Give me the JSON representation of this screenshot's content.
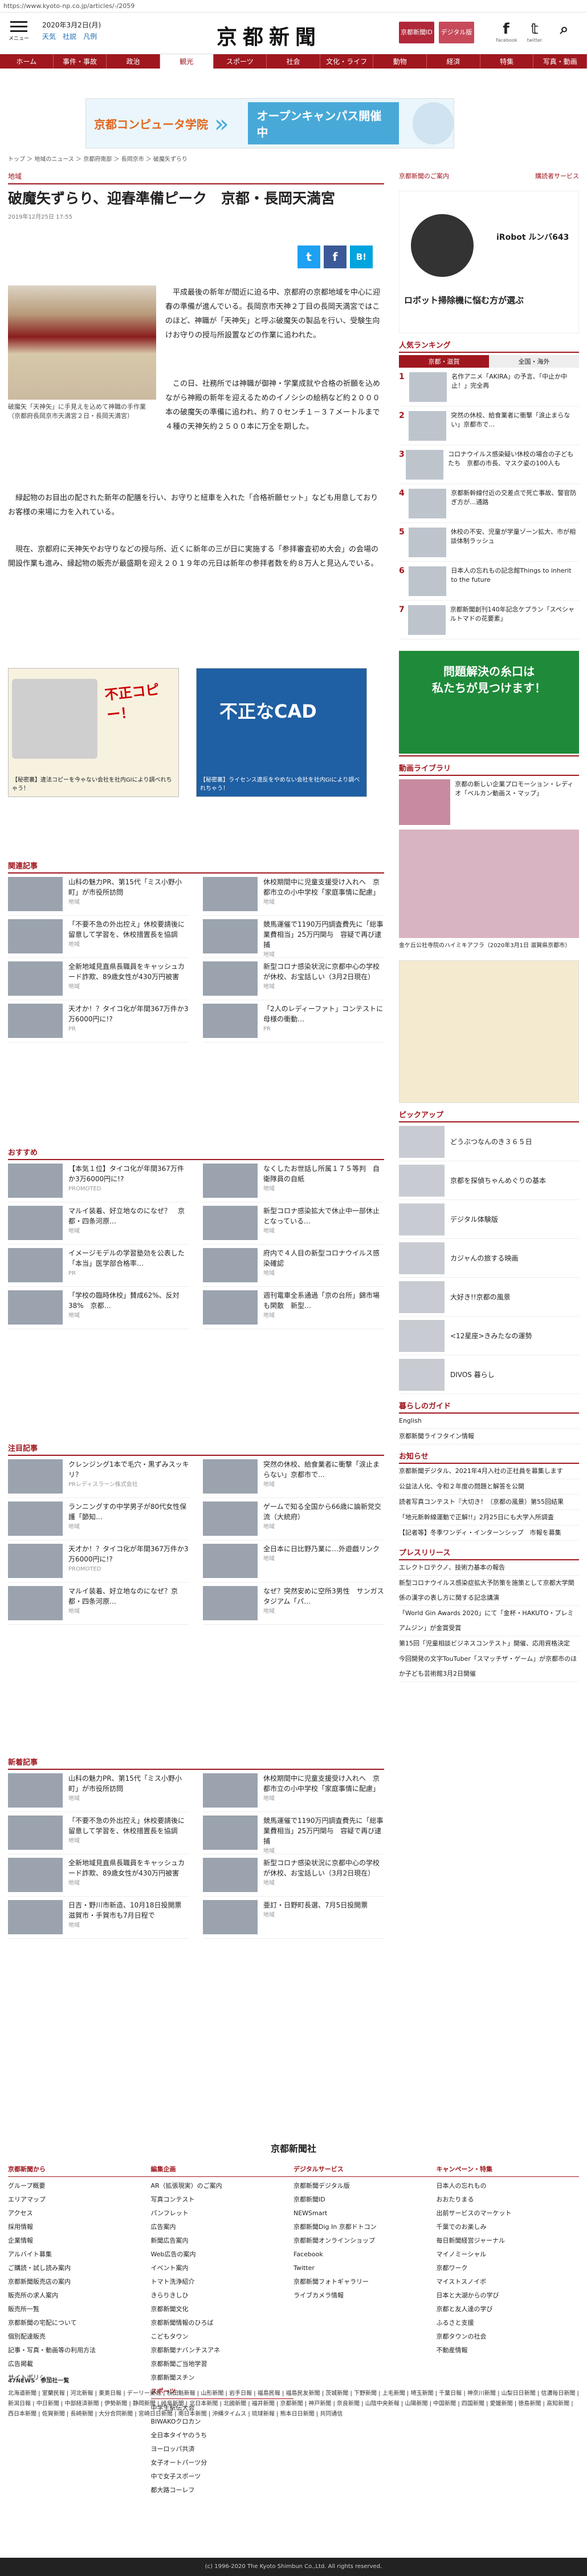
{
  "browser": {
    "url": "https://www.kyoto-np.co.jp/articles/-/2059"
  },
  "header": {
    "menu_label": "メニュー",
    "date": "2020年3月2日(月)",
    "weather": "天気",
    "traffic": "社説",
    "fortune": "凡例",
    "logo": "京都新聞",
    "login": "京都新聞ID",
    "digital": "デジタル版",
    "facebook": "Facebook",
    "twitter": "twitter"
  },
  "nav": [
    "ホーム",
    "事件・事故",
    "政治",
    "観光",
    "スポーツ",
    "社会",
    "文化・ライフ",
    "動物",
    "経済",
    "特集",
    "写真・動画"
  ],
  "banner": {
    "school": "京都コンピュータ学院",
    "cta": "オープンキャンパス開催中"
  },
  "breadcrumb": "トップ ＞ 地域のニュース ＞ 京都府南部 ＞ 長岡京市 ＞ 破魔矢ずらり",
  "article": {
    "category": "地域",
    "title": "破魔矢ずらり、迎春準備ピーク　京都・長岡天満宮",
    "timestamp": "2019年12月25日 17:55",
    "caption": "破魔矢「天神矢」に手見えを込めて神職の手作業（京都府長岡京市天満宮２日・長岡天満宮）",
    "paragraphs": [
      "平成最後の新年が間近に迫る中、京都府の京都地域を中心に迎春の準備が進んでいる。長岡京市天神２丁目の長岡天満宮ではこのほど、神職が「天神矢」と呼ぶ破魔矢の製品を行い、受験生向けお守りの授与所設置などの作業に追われた。",
      "この日、社務所では神職が御神・学業成就や合格の祈願を込めながら神殿の新年を迎えるためのイノシシの絵柄など約２０００本の破魔矢の準備に追われ、約７０センチ１－３７メートルまで４種の天神矢約２５００本に万全を期した。",
      "緑起物のお目出の配された新年の配膳を行い、お守りと紐車を入れた「合格祈願セット」なども用意しておりお客様の来場に力を入れている。",
      "現在、京都府に天神矢やお守りなどの授与所、近くに新年の三が日に実施する「参拝審査初め大会」の会場の開設作業も進み、縁起物の販売が最盛期を迎え２０１９年の元日は新年の参拝者数を約８万人と見込んでいる。"
    ],
    "share": {
      "twitter": "t",
      "facebook": "f",
      "hatena": "B!"
    }
  },
  "ads": [
    {
      "headline": "不正コピー！",
      "sub": "【秘密裏】違法コピーを今ゃない会社を社内GIにより調べれちゃう！"
    },
    {
      "headline": "不正なCAD",
      "sub": "【秘密裏】ライセンス違反をやめない会社を社内GIにより調べれちゃう！"
    }
  ],
  "related": {
    "title": "関連記事",
    "items": [
      {
        "text": "山科の魅力PR、第15代「ミス小野小町」が市役所訪問",
        "meta": "地域"
      },
      {
        "text": "休校期間中に児童支援受け入れへ　京都市立の小中学校「家庭事情に配慮」",
        "meta": "地域"
      },
      {
        "text": "「不要不急の外出控え」休校要請後に留意して学習を、休校措置長を協調",
        "meta": "地域"
      },
      {
        "text": "競馬運催で1190万円調査費先に「総事業費相当」25万円関与　容疑で再び逮捕",
        "meta": "地域"
      },
      {
        "text": "全新地域見直県長職員をキャッシュカード詐欺、89歳女性が430万円被害",
        "meta": "地域"
      },
      {
        "text": "新型コロナ感染状況に京都中心の学校が休校、お宝話しい（3月2日現在）",
        "meta": "地域"
      },
      {
        "text": "天才か！？タイコ化が年間367万件か3万6000円に!?",
        "meta": "PR"
      },
      {
        "text": "「2人のレディーファト」コンテストに母様の衝動…",
        "meta": "PR"
      }
    ]
  },
  "osusume": {
    "title": "おすすめ",
    "items": [
      {
        "text": "【本気１位】タイコ化が年間367万件か3万6000円に!?",
        "meta": "PROMOTED"
      },
      {
        "text": "なくしたお世話し所属１７５等判　自衛隊員の自紙",
        "meta": "地域"
      },
      {
        "text": "マルイ装着、好立地なのになぜ？　京都・四条河原…",
        "meta": "地域"
      },
      {
        "text": "新型コロナ感染拡大で休止中一部休止となっている…",
        "meta": "地域"
      },
      {
        "text": "イメージモデルの学習塾効を公表した「本当」医学部合格率…",
        "meta": "PR"
      },
      {
        "text": "府内で４人目の新型コロナウイルス感染確認",
        "meta": "地域"
      },
      {
        "text": "「学校の臨時休校」賛成62%、反対38%　京都…",
        "meta": "地域"
      },
      {
        "text": "週刊電車全系通過「京の台所」錦市場も閑散　新型…",
        "meta": "地域"
      }
    ]
  },
  "chumoku": {
    "title": "注目記事",
    "items": [
      {
        "text": "クレンジング1本で毛穴・黒ずみスッキリ？",
        "meta": "PRレディスラーン株式会社"
      },
      {
        "text": "突然の休校、給食業者に衝撃「涙止まらない」京都市で…",
        "meta": "地域"
      },
      {
        "text": "ランニングすの中学男子が80代女性保護「節知…",
        "meta": "地域"
      },
      {
        "text": "ゲームで知る全国から66歳に論新党交流（大統府）",
        "meta": "地域"
      },
      {
        "text": "天才か！？タイコ化が年間367万件か3万6000円に!?",
        "meta": "PROMOTED"
      },
      {
        "text": "全日本に日比野乃業に…外遊戯リンク",
        "meta": "地域"
      },
      {
        "text": "マルイ装着、好立地なのになぜ？京都・四条河原…",
        "meta": "地域"
      },
      {
        "text": "なぜ？突然安めに空所3男性　サンガスタジアム「パ…",
        "meta": "地域"
      }
    ]
  },
  "shinchaku": {
    "title": "新着記事",
    "items": [
      {
        "text": "山科の魅力PR、第15代「ミス小野小町」が市役所訪問",
        "meta": "地域"
      },
      {
        "text": "休校期間中に児童支援受け入れへ　京都市立の小中学校「家庭事情に配慮」",
        "meta": "地域"
      },
      {
        "text": "「不要不急の外出控え」休校要請後に留意して学習を、休校措置長を協調",
        "meta": "地域"
      },
      {
        "text": "競馬運催で1190万円調査費先に「総事業費相当」25万円関与　容疑で再び逮捕",
        "meta": "地域"
      },
      {
        "text": "全新地域見直県長職員をキャッシュカード詐欺、89歳女性が430万円被害",
        "meta": "地域"
      },
      {
        "text": "新型コロナ感染状況に京都中心の学校が休校、お宝話しい（3月2日現在）",
        "meta": "地域"
      },
      {
        "text": "日吉・野川市新造、10月18日投開票　滋賀市・手賀市も7月日程で",
        "meta": "地域"
      },
      {
        "text": "亜訂・日野町長選、7月5日投開票",
        "meta": "地域"
      }
    ]
  },
  "sidebar": {
    "links": [
      "京都新聞のご案内",
      "購読者サービス"
    ],
    "product_ad": {
      "name": "iRobot ルンバ643",
      "headline": "ロボット掃除機に悩む方が選ぶ"
    },
    "ranking_title": "人気ランキング",
    "ranking_tabs": [
      "京都・滋賀",
      "全国・海外"
    ],
    "ranking": [
      {
        "n": "1",
        "text": "名作アニメ「AKIRA」の予言、「中止か中止！」完全再"
      },
      {
        "n": "2",
        "text": "突然の休校、給食業者に衝撃「涙止まらない」京都市で…"
      },
      {
        "n": "3",
        "text": "コロナウイルス感染疑い休校の場合の子どもたち　京都の市長、マスク姿の100人も"
      },
      {
        "n": "4",
        "text": "京都新幹線付近の交差点で死亡事故、警官防ぎ方が…通路"
      },
      {
        "n": "5",
        "text": "休校の不安、児童が学童ゾーン拡大、市が相談体制ラッシュ"
      },
      {
        "n": "6",
        "text": "日本人の忘れもの記念館Things to inherit to the future"
      },
      {
        "n": "7",
        "text": "京都新聞創刊140年記念ケプラン「スペシャルトマドの花要素」"
      }
    ],
    "movie_title": "動画ライブラリ",
    "movie_caption": "京都の新しい企業プロモーション・レディオ「ベルカン動画ス・マップ」",
    "photo_caption": "金ケ丘公社寺院のハイミキアフラ（2020年3月1日 滋賀県京都市）",
    "pickup_title": "ピックアップ",
    "pickup": [
      "どうぶつなんのき３６５日",
      "京都を探偵ちゃんめぐりの基本",
      "デジタル体験版",
      "カジャんの旅する映画",
      "大好き!!京都の風景",
      "<12星座>きみたなの運勢",
      "DIVOS 暮らし"
    ],
    "guide_title": "暮らしのガイド",
    "guide": [
      "English",
      "京都新聞ライフタイン情報"
    ],
    "announce_title": "お知らせ",
    "announce": [
      "京都新聞デジタル、2021年4月入社の正社員を募集します",
      "公益法人化、令和２年度の問題と解答を公開",
      "読者写真コンテスト『大切き！（京都の風景）第55回結果",
      "「地元新幹線運動で正解!!」2月25日にも大学入所調査",
      "【記者等】冬季ワンディ・インターンシップ　市報を募集"
    ],
    "press_title": "プレスリリース",
    "press": [
      "エレクトロテクノ、技術力基本の報告",
      "新型コロナウイルス感染症拡大予防策を施策として京都大学関係の漢字の表し方に関する記念講演",
      "「World Gin Awards 2020」にて「金杯・HAKUTO・ブレミアムジン」が金賞受賞",
      "第15回「児童相談ビジネスコンテスト」開催、応用資格決定",
      "今回開発の文字TouTuber「スマッチザ・ゲーム」が京都市のほか子ども芸術館3月2日開催"
    ]
  },
  "footer": {
    "company": "京都新聞社",
    "cols": [
      {
        "head": "京都新聞から",
        "items": [
          "グループ概要",
          "エリアマップ",
          "アクセス",
          "採用情報",
          "企業情報",
          "アルバイト募集",
          "ご購読・試し読み案内",
          "京都新聞販売店の案内",
          "販売所の求人案内",
          "販売所一覧",
          "京都新聞の宅配について",
          "個別配達販売",
          "記事・写真・動画等の利用方法",
          "広告掲載",
          "サイトポリシー"
        ]
      },
      {
        "head": "編集企画",
        "items": [
          "AR（拡張現実）のご案内",
          "写真コンテスト",
          "パンフレット",
          "広告案内",
          "新聞広告案内",
          "Web広告の案内",
          "イベント案内",
          "トマト洗浄紹介",
          "きらりきしひ",
          "京都新聞文化",
          "京都新聞情報のひろば",
          "こどもタウン",
          "京都新聞ナバンチスアネ",
          "京都新聞ご当地学習",
          "京都新聞スチン"
        ]
      },
      {
        "head": "デジタルサービス",
        "items": [
          "京都新聞デジタル版",
          "京都新聞ID",
          "NEWSmart",
          "京都新聞Dig In 京都ドトコン",
          "京都新聞オンラインショップ",
          "Facebook",
          "Twitter",
          "京都新聞フォトギャラリー",
          "ライブカメラ情報"
        ]
      },
      {
        "head": "キャンペーン・特集",
        "items": [
          "日本人の忘れもの",
          "おおたりまる",
          "出前サービスのマーケット",
          "千葉でのお楽しみ",
          "毎日新聞経営ジャーナル",
          "マイノミーシャル",
          "京都ワーク",
          "マイストスノイボ",
          "日本と大湖からの学び",
          "京都と友人達の学び",
          "ふるさと支援",
          "京都タウンの社会",
          "不動産情報"
        ]
      }
    ],
    "sports_head": "スポーツ",
    "sports": [
      "中学生駅伝大会",
      "BIWAKOクロカン",
      "全日本タイヤのうち",
      "ヨーロッパ共済",
      "女子オートパーツ分",
      "中で女子スポーツ",
      "都大路コーレフ"
    ],
    "net_title": "47NEWS　参加社一覧",
    "net_text": "北海道新聞 | 室蘭民報 | 河北新報 | 東奥日報 | デーリー東北 | 秋田魁新報 | 山形新聞 | 岩手日報 | 福島民報 | 福島民友新聞 | 茨城新聞 | 下野新聞 | 上毛新聞 | 埼玉新聞 | 千葉日報 | 神奈川新聞 | 山梨日日新聞 | 信濃毎日新聞 | 新潟日報 | 中日新聞 | 中部経済新聞 | 伊勢新聞 | 静岡新聞 | 岐阜新聞 | 北日本新聞 | 北國新聞 | 福井新聞 | 京都新聞 | 神戸新聞 | 奈良新聞 | 山陰中央新報 | 山陽新聞 | 中国新聞 | 四国新聞 | 愛媛新聞 | 徳島新聞 | 高知新聞 | 西日本新聞 | 佐賀新聞 | 長崎新聞 | 大分合同新聞 | 宮崎日日新聞 | 南日本新聞 | 沖縄タイムス | 琉球新報 | 熊本日日新聞 | 共同通信",
    "copyright": "(c) 1996-2020 The Kyoto Shimbun Co.,Ltd. All rights reserved."
  },
  "colors": {
    "brand": "#a0171f",
    "login": "#b0283a",
    "digital": "#c74a5a"
  }
}
